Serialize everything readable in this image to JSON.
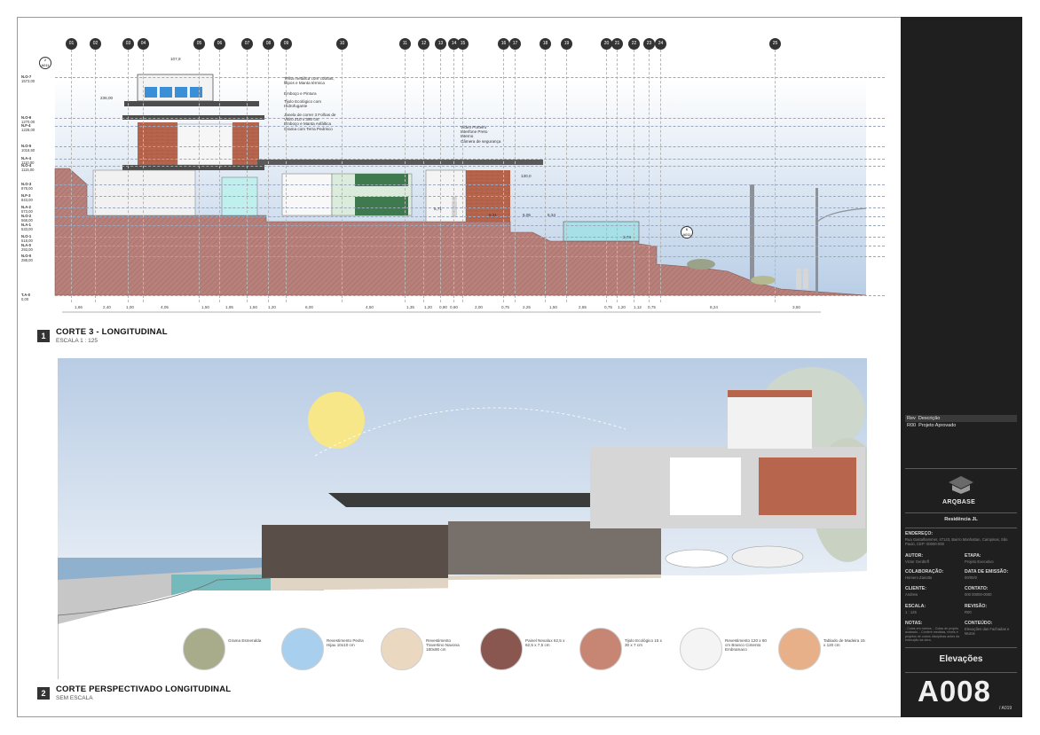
{
  "section1": {
    "number": "1",
    "title": "CORTE 3 - LONGITUDINAL",
    "scale": "ESCALA 1 : 125"
  },
  "section2": {
    "number": "2",
    "title": "CORTE PERSPECTIVADO LONGITUDINAL",
    "scale": "SEM ESCALA"
  },
  "grid_labels": [
    "01",
    "02",
    "03",
    "04",
    "05",
    "06",
    "07",
    "08",
    "09",
    "10",
    "11",
    "12",
    "13",
    "14",
    "15",
    "16",
    "17",
    "18",
    "19",
    "20",
    "21",
    "22",
    "23",
    "24",
    "25"
  ],
  "levels": [
    {
      "name": "N.O-7",
      "value": "1573,00"
    },
    {
      "name": "N.O-6",
      "value": "1270,00"
    },
    {
      "name": "N.F-4",
      "value": "1228,00"
    },
    {
      "name": "N.O-5",
      "value": "1018,50"
    },
    {
      "name": "N.A-4",
      "value": "1110,00"
    },
    {
      "name": "N.O-4",
      "value": "1115,00"
    },
    {
      "name": "N.O-3",
      "value": "878,00"
    },
    {
      "name": "N.F-3",
      "value": "843,00"
    },
    {
      "name": "N.A-2",
      "value": "573,00"
    },
    {
      "name": "N.O-2",
      "value": "568,00"
    },
    {
      "name": "N.A-1",
      "value": "533,00"
    },
    {
      "name": "N.O-1",
      "value": "518,00"
    },
    {
      "name": "N.A-0",
      "value": "293,00"
    },
    {
      "name": "N.O-0",
      "value": "288,00"
    },
    {
      "name": "T.A-0",
      "value": "0,00"
    }
  ],
  "dimensions": [
    "1,66",
    "2,40",
    "1,00",
    "4,05",
    "1,50",
    "1,95",
    "1,50",
    "1,20",
    "6,00",
    "4,50",
    "1,35",
    "1,20",
    "0,90",
    "0,60",
    "2,00",
    "0,75",
    "2,25",
    "1,50",
    "2,85",
    "0,75",
    "1,20",
    "1,12",
    "0,75",
    "8,24",
    "3,50"
  ],
  "notes_roof": [
    "Telha metálica com cobrias, filipos e Manta térmica",
    "Emboço e Pintura",
    "Tijolo Ecológico com Hidrofugante",
    "Janela de correr 3 Folhas de Vidro 210 x 380 cm",
    "Emboço e Manta Asfáltica",
    "Grama com Terra Pedrisco"
  ],
  "notes_gate": [
    "Vídeo Porteiro",
    "Interfone Preto",
    "Interno",
    "Câmera de segurança"
  ],
  "small_annotations": {
    "dim_top": "107,9",
    "dim_left": "236,00",
    "dim_canopy": "130,0",
    "level_571": "5,71",
    "level_521": "5,21",
    "level_505": "5,05",
    "level_534": "5,34",
    "level_274": "2,74",
    "callout_a": "2",
    "callout_a_sheet": "A011",
    "callout_b": "6",
    "callout_b_sheet": "A011"
  },
  "materials": [
    {
      "name": "Grama Esmeralda",
      "color": "#a8ac8a"
    },
    {
      "name": "Revestimento Pedra Hijau 10x10 cm",
      "color": "#a9cfee"
    },
    {
      "name": "Revestimento Travertino Navona 180x90 cm",
      "color": "#ead8c0"
    },
    {
      "name": "Painel Nexalux 62,5 x 62,5 x 7,5 cm",
      "color": "#8a5650"
    },
    {
      "name": "Tijolo Ecológico 15 x 30 x 7 cm",
      "color": "#c78674"
    },
    {
      "name": "Revestimento 120 x 60 cm Branco Cimento Embramaco",
      "color": "#f4f4f4"
    },
    {
      "name": "Tablado de Madeira 15 x 120 cm",
      "color": "#e8b088"
    }
  ],
  "revisions": {
    "header_rev": "Rev",
    "header_desc": "Descrição",
    "rows": [
      {
        "rev": "R00",
        "desc": "Projeto Aprovado"
      }
    ]
  },
  "titleblock": {
    "logo_text": "ARQBASE",
    "project": "Residência JL",
    "endereco_label": "ENDEREÇO:",
    "endereco": "Rua Gastalhammer, 47143, Bairro Manhattan, Campinas, São Paulo, CEP: 00000-000",
    "autor_label": "AUTOR:",
    "autor": "Victor Gerdteff",
    "etapa_label": "ETAPA:",
    "etapa": "Projeto Executivo",
    "colaboracao_label": "COLABORAÇÃO:",
    "colaboracao": "Homero Zanotto",
    "data_label": "DATA DE EMISSÃO:",
    "data": "00/00/0",
    "cliente_label": "CLIENTE:",
    "cliente": "Andrew",
    "contato_label": "CONTATO:",
    "contato": "000 00000-0000",
    "escala_label": "ESCALA:",
    "escala": "1 : 125",
    "revisao_label": "REVISÃO:",
    "revisao": "R00",
    "notas_label": "NOTAS:",
    "notas": "- Cotas em metros. - Cotas de projeto acabado. - Conferir medidas, níveis e projetos de outros disciplinas antes da execução da obra.",
    "conteudo_label": "CONTEÚDO:",
    "conteudo": "Elevações das Fachadas e Muros",
    "sheet_content": "Elevações",
    "sheet_number": "A008",
    "sheet_total": "/ A019"
  },
  "colors": {
    "earth": "#b8807a",
    "sky_top": "#ffffff",
    "sky_bottom": "#b9cee6",
    "brick": "#b8654e",
    "dark": "#1f1f1f",
    "pool": "#a8e0e8",
    "sun": "#f7e788"
  }
}
